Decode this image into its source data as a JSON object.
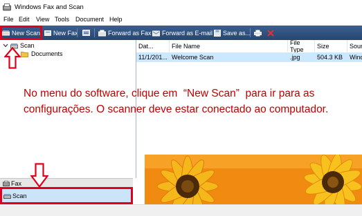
{
  "window": {
    "title": "Windows Fax and Scan"
  },
  "menu": {
    "items": [
      "File",
      "Edit",
      "View",
      "Tools",
      "Document",
      "Help"
    ]
  },
  "toolbar": {
    "new_scan": "New Scan",
    "new_fax": "New Fax",
    "forward_fax": "Forward as Fax",
    "forward_email": "Forward as E-mail",
    "save_as": "Save as..."
  },
  "tree": {
    "root": "Scan",
    "child": "Documents"
  },
  "nav": {
    "fax": "Fax",
    "scan": "Scan"
  },
  "list": {
    "columns": [
      "Dat...",
      "File Name",
      "File Type",
      "Size",
      "Sour"
    ],
    "rows": [
      {
        "date": "11/1/201...",
        "name": "Welcome Scan",
        "type": ".jpg",
        "size": "504.3 KB",
        "source": "Windo"
      }
    ]
  },
  "annotation": {
    "text": "No menu do software, clique em  “New Scan”  para ir para as configurações. O scanner deve estar conectado ao computador."
  },
  "colors": {
    "toolbar": "#2f5384",
    "highlight": "#e0001b",
    "annotation_text": "#c00000",
    "selection": "#cce8ff"
  }
}
